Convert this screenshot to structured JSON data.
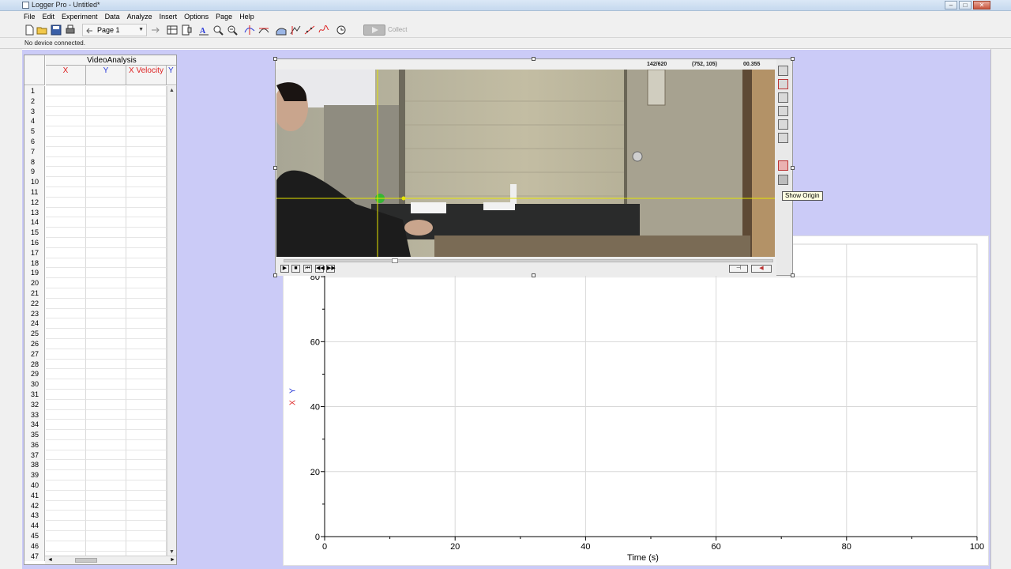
{
  "window": {
    "title": "Logger Pro - Untitled*"
  },
  "menu": [
    "File",
    "Edit",
    "Experiment",
    "Data",
    "Analyze",
    "Insert",
    "Options",
    "Page",
    "Help"
  ],
  "toolbar": {
    "page_label": "Page 1",
    "collect_label": "Collect"
  },
  "status": {
    "text": "No device connected."
  },
  "table": {
    "dataset_name": "VideoAnalysis",
    "columns": [
      {
        "label": "X",
        "color": "#dd2020"
      },
      {
        "label": "Y",
        "color": "#2838d8"
      },
      {
        "label": "X Velocity",
        "color": "#dd2020"
      },
      {
        "label": "Y",
        "color": "#2838d8"
      }
    ],
    "row_numbers": [
      "1",
      "2",
      "3",
      "4",
      "5",
      "6",
      "7",
      "8",
      "9",
      "10",
      "11",
      "12",
      "13",
      "14",
      "15",
      "16",
      "17",
      "18",
      "19",
      "20",
      "21",
      "22",
      "23",
      "24",
      "25",
      "26",
      "27",
      "28",
      "29",
      "30",
      "31",
      "32",
      "33",
      "34",
      "35",
      "36",
      "37",
      "38",
      "39",
      "40",
      "41",
      "42",
      "43",
      "44",
      "45",
      "46",
      "47"
    ]
  },
  "video": {
    "frame_readout": "142/620",
    "coord_readout": "(752, 105)",
    "time_readout": "00.355",
    "tooltip": "Show Origin"
  },
  "graph": {
    "xlabel": "Time (s)",
    "ylabel_y": "Y",
    "ylabel_x": "X"
  },
  "chart_data": {
    "type": "scatter",
    "title": "",
    "xlabel": "Time (s)",
    "ylabel": "X Y",
    "xlim": [
      0,
      100
    ],
    "ylim": [
      0,
      90
    ],
    "x_ticks": [
      "0",
      "20",
      "40",
      "60",
      "80",
      "100"
    ],
    "y_ticks": [
      "0",
      "20",
      "40",
      "60",
      "80"
    ],
    "grid": true,
    "series": []
  },
  "colors": {
    "page_bg": "#cbcbf7",
    "axis_tick": "#000000",
    "grid": "#d8d8d8",
    "crosshair": "#e6e600"
  }
}
